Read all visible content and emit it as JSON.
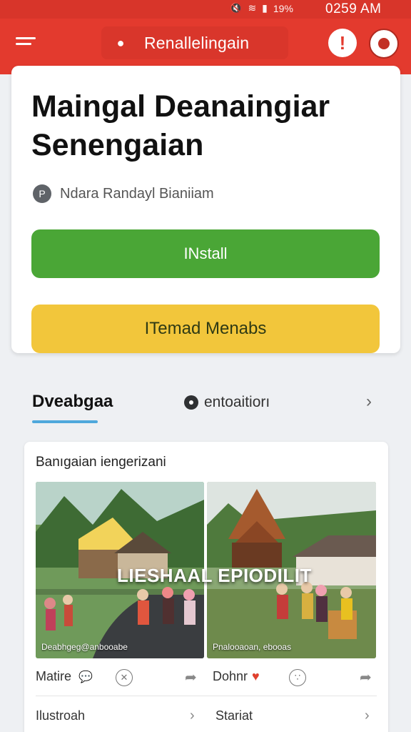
{
  "status_bar": {
    "icons": [
      "mute-icon",
      "wifi-icon",
      "signal-icon",
      "battery-icon"
    ],
    "battery": "19%",
    "time": "0259 AM"
  },
  "header": {
    "title": "Renallelingain",
    "brand_color": "#e33a2e"
  },
  "app": {
    "title": "Maingal Deanaingiar Senengaian",
    "developer": "Ndara Randayl Bianiiam",
    "install_label": "INstall",
    "secondary_label": "ITemad Menabs",
    "install_color": "#4aa636",
    "secondary_color": "#f2c63b"
  },
  "tabs": {
    "active": "Dveabgaa",
    "other": "entoaitiorı"
  },
  "gallery": {
    "title": "Banıgaian iengerizani",
    "photos": [
      {
        "caption": "Deabhgeg@anbooabe"
      },
      {
        "caption": "Pnalooaoan, ebooas"
      }
    ],
    "overlay_text": "LIESHAAL EPIODILIT",
    "actions": {
      "left_label": "Matire",
      "right_label": "Dohnr"
    },
    "rows": {
      "left": "Ilustroah",
      "right": "Stariat"
    }
  }
}
